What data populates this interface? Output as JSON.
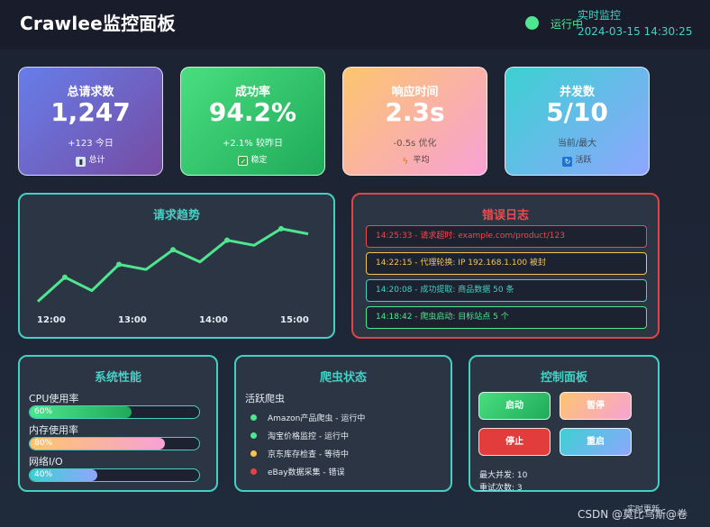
{
  "header": {
    "title": "Crawlee监控面板",
    "status": "运行中",
    "live_label": "实时监控",
    "timestamp": "2024-03-15 14:30:25",
    "status_color": "#4ee68f"
  },
  "stats": [
    {
      "label": "总请求数",
      "value": "1,247",
      "sub": "+123 今日",
      "foot": "总计",
      "icon": "bar-chart-icon"
    },
    {
      "label": "成功率",
      "value": "94.2%",
      "sub": "+2.1% 较昨日",
      "foot": "稳定",
      "icon": "check-box-icon"
    },
    {
      "label": "响应时间",
      "value": "2.3s",
      "sub": "-0.5s 优化",
      "foot": "平均",
      "icon": "lightning-icon"
    },
    {
      "label": "并发数",
      "value": "5/10",
      "sub": "当前/最大",
      "foot": "活跃",
      "icon": "refresh-icon"
    }
  ],
  "trend": {
    "title": "请求趋势",
    "ticks": [
      "12:00",
      "13:00",
      "14:00",
      "15:00"
    ],
    "line_color": "#4ee68f"
  },
  "chart_data": {
    "type": "line",
    "title": "请求趋势",
    "x": [
      0,
      1,
      2,
      3,
      4,
      5,
      6,
      7,
      8,
      9,
      10
    ],
    "categories": [
      "12:00",
      "13:00",
      "14:00",
      "15:00"
    ],
    "values": [
      2,
      40,
      19,
      60,
      52,
      83,
      64,
      98,
      90,
      116,
      108
    ],
    "ylim": [
      0,
      130
    ],
    "grid": false
  },
  "errors": {
    "title": "错误日志",
    "logs": [
      {
        "text": "14:25:33 - 请求超时: example.com/product/123",
        "color": "#ef4a4a"
      },
      {
        "text": "14:22:15 - 代理轮换: IP 192.168.1.100 被封",
        "color": "#f6c453"
      },
      {
        "text": "14:20:08 - 成功提取: 商品数据 50 条",
        "color": "#44d1c4"
      },
      {
        "text": "14:18:42 - 爬虫启动: 目标站点 5 个",
        "color": "#4ee68f"
      }
    ]
  },
  "performance": {
    "title": "系统性能",
    "metrics": [
      {
        "label": "CPU使用率",
        "value_text": "60%",
        "value": 0.6
      },
      {
        "label": "内存使用率",
        "value_text": "80%",
        "value": 0.8
      },
      {
        "label": "网络I/O",
        "value_text": "40%",
        "value": 0.4
      }
    ]
  },
  "crawler": {
    "title": "爬虫状态",
    "heading": "活跃爬虫",
    "items": [
      {
        "text": "Amazon产品爬虫 - 运行中",
        "color": "#4ee68f"
      },
      {
        "text": "淘宝价格监控 - 运行中",
        "color": "#4ee68f"
      },
      {
        "text": "京东库存检查 - 等待中",
        "color": "#f6c453"
      },
      {
        "text": "eBay数据采集 - 错误",
        "color": "#e04545"
      }
    ]
  },
  "control": {
    "title": "控制面板",
    "start": "启动",
    "pause": "暂停",
    "stop": "停止",
    "restart": "重启",
    "max_concurrency": "最大并发: 10",
    "retries": "重试次数: 3"
  },
  "watermark": "CSDN @莫比乌斯@卷",
  "overlay_text": "实时更新"
}
